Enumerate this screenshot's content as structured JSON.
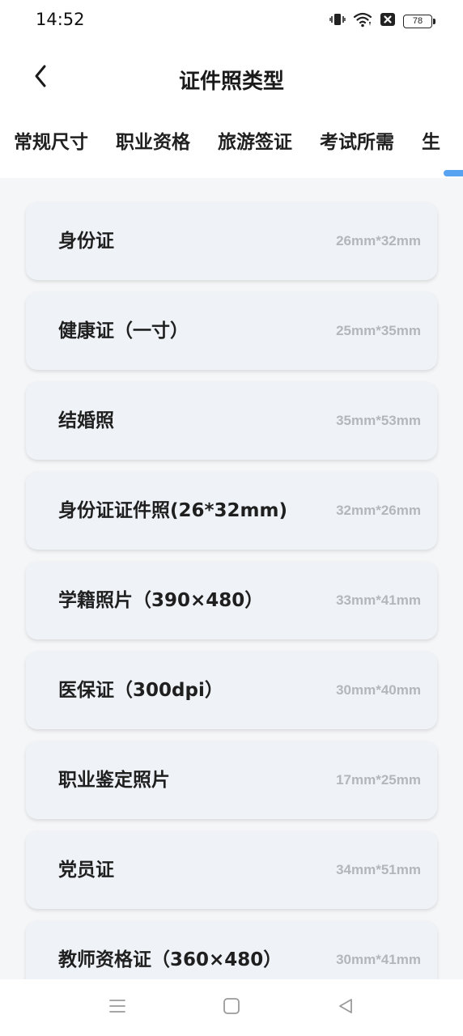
{
  "status_bar": {
    "time": "14:52",
    "battery": "78",
    "icons": [
      "vibrate-icon",
      "wifi-icon",
      "sim-blocked-icon",
      "battery-icon"
    ]
  },
  "header": {
    "title": "证件照类型",
    "back_icon": "chevron-left-icon"
  },
  "tabs": [
    {
      "label": "常规尺寸"
    },
    {
      "label": "职业资格"
    },
    {
      "label": "旅游签证"
    },
    {
      "label": "考试所需"
    },
    {
      "label": "生"
    }
  ],
  "accent_color": "#58a3f1",
  "items": [
    {
      "name": "身份证",
      "size": "26mm*32mm"
    },
    {
      "name": "健康证（一寸）",
      "size": "25mm*35mm"
    },
    {
      "name": "结婚照",
      "size": "35mm*53mm"
    },
    {
      "name": "身份证证件照(26*32mm)",
      "size": "32mm*26mm"
    },
    {
      "name": "学籍照片（390×480）",
      "size": "33mm*41mm"
    },
    {
      "name": "医保证（300dpi）",
      "size": "30mm*40mm"
    },
    {
      "name": "职业鉴定照片",
      "size": "17mm*25mm"
    },
    {
      "name": "党员证",
      "size": "34mm*51mm"
    },
    {
      "name": "教师资格证（360×480）",
      "size": "30mm*41mm"
    }
  ],
  "nav_bar": {
    "icons": [
      "menu-icon",
      "home-square-icon",
      "back-triangle-icon"
    ]
  }
}
